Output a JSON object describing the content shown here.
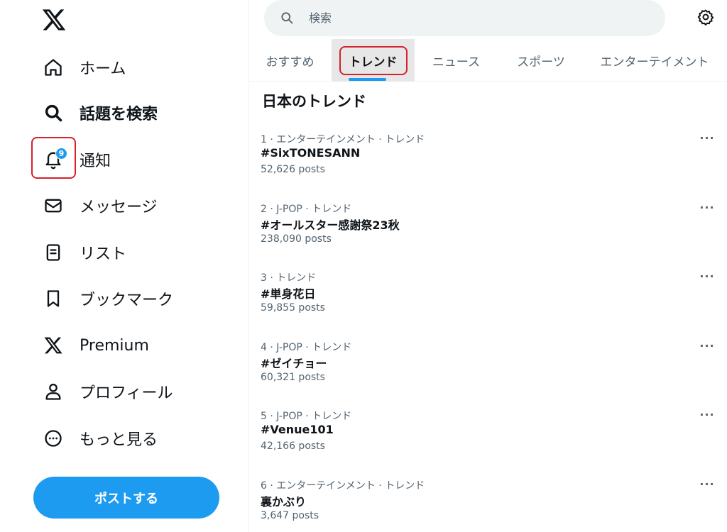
{
  "sidebar": {
    "logo": "x-logo-icon",
    "items": [
      {
        "label": "ホーム",
        "icon": "home-icon"
      },
      {
        "label": "話題を検索",
        "icon": "search-icon"
      },
      {
        "label": "通知",
        "icon": "bell-icon",
        "badge": "9"
      },
      {
        "label": "メッセージ",
        "icon": "mail-icon"
      },
      {
        "label": "リスト",
        "icon": "list-icon"
      },
      {
        "label": "ブックマーク",
        "icon": "bookmark-icon"
      },
      {
        "label": "Premium",
        "icon": "x-logo-icon"
      },
      {
        "label": "プロフィール",
        "icon": "person-icon"
      },
      {
        "label": "もっと見る",
        "icon": "more-circle-icon"
      }
    ],
    "post_button": "ポストする"
  },
  "search": {
    "placeholder": "検索"
  },
  "tabs": [
    {
      "label": "おすすめ"
    },
    {
      "label": "トレンド",
      "active": true
    },
    {
      "label": "ニュース"
    },
    {
      "label": "スポーツ"
    },
    {
      "label": "エンターテイメント"
    }
  ],
  "section_title": "日本のトレンド",
  "trends": [
    {
      "meta": "1 · エンターテインメント · トレンド",
      "name": "#SixTONESANN",
      "count": "52,626 posts"
    },
    {
      "meta": "2 · J-POP · トレンド",
      "name": "#オールスター感謝祭23秋",
      "count": "238,090 posts"
    },
    {
      "meta": "3 · トレンド",
      "name": "#単身花日",
      "count": "59,855 posts"
    },
    {
      "meta": "4 · J-POP · トレンド",
      "name": "#ゼイチョー",
      "count": "60,321 posts"
    },
    {
      "meta": "5 · J-POP · トレンド",
      "name": "#Venue101",
      "count": "42,166 posts"
    },
    {
      "meta": "6 · エンターテインメント · トレンド",
      "name": "裏かぶり",
      "count": "3,647 posts"
    }
  ],
  "more_glyph": "···",
  "colors": {
    "accent": "#1d9bf0",
    "highlight": "#d6202c",
    "text": "#0f1419",
    "secondary": "#536471"
  }
}
